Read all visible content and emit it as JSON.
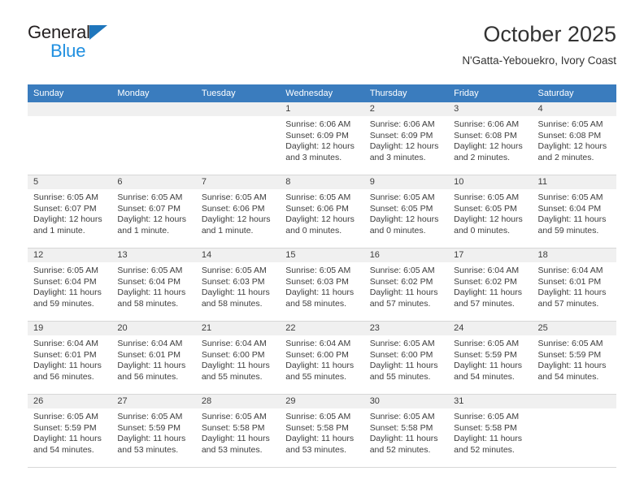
{
  "brand": {
    "line1": "General",
    "line2": "Blue",
    "triangle_color": "#1f76bc",
    "blue_text_color": "#1f8fe0"
  },
  "header": {
    "title": "October 2025",
    "subtitle": "N'Gatta-Yebouekro, Ivory Coast",
    "header_bg_color": "#3a7cbe",
    "daynum_band_color": "#f0f0f0"
  },
  "weekdays": [
    "Sunday",
    "Monday",
    "Tuesday",
    "Wednesday",
    "Thursday",
    "Friday",
    "Saturday"
  ],
  "labels": {
    "sunrise_prefix": "Sunrise:",
    "sunset_prefix": "Sunset:",
    "daylight_prefix": "Daylight:"
  },
  "weeks": [
    [
      {
        "day": "",
        "empty": true
      },
      {
        "day": "",
        "empty": true
      },
      {
        "day": "",
        "empty": true
      },
      {
        "day": "1",
        "sunrise": "Sunrise: 6:06 AM",
        "sunset": "Sunset: 6:09 PM",
        "daylight1": "Daylight: 12 hours",
        "daylight2": "and 3 minutes."
      },
      {
        "day": "2",
        "sunrise": "Sunrise: 6:06 AM",
        "sunset": "Sunset: 6:09 PM",
        "daylight1": "Daylight: 12 hours",
        "daylight2": "and 3 minutes."
      },
      {
        "day": "3",
        "sunrise": "Sunrise: 6:06 AM",
        "sunset": "Sunset: 6:08 PM",
        "daylight1": "Daylight: 12 hours",
        "daylight2": "and 2 minutes."
      },
      {
        "day": "4",
        "sunrise": "Sunrise: 6:05 AM",
        "sunset": "Sunset: 6:08 PM",
        "daylight1": "Daylight: 12 hours",
        "daylight2": "and 2 minutes."
      }
    ],
    [
      {
        "day": "5",
        "sunrise": "Sunrise: 6:05 AM",
        "sunset": "Sunset: 6:07 PM",
        "daylight1": "Daylight: 12 hours",
        "daylight2": "and 1 minute."
      },
      {
        "day": "6",
        "sunrise": "Sunrise: 6:05 AM",
        "sunset": "Sunset: 6:07 PM",
        "daylight1": "Daylight: 12 hours",
        "daylight2": "and 1 minute."
      },
      {
        "day": "7",
        "sunrise": "Sunrise: 6:05 AM",
        "sunset": "Sunset: 6:06 PM",
        "daylight1": "Daylight: 12 hours",
        "daylight2": "and 1 minute."
      },
      {
        "day": "8",
        "sunrise": "Sunrise: 6:05 AM",
        "sunset": "Sunset: 6:06 PM",
        "daylight1": "Daylight: 12 hours",
        "daylight2": "and 0 minutes."
      },
      {
        "day": "9",
        "sunrise": "Sunrise: 6:05 AM",
        "sunset": "Sunset: 6:05 PM",
        "daylight1": "Daylight: 12 hours",
        "daylight2": "and 0 minutes."
      },
      {
        "day": "10",
        "sunrise": "Sunrise: 6:05 AM",
        "sunset": "Sunset: 6:05 PM",
        "daylight1": "Daylight: 12 hours",
        "daylight2": "and 0 minutes."
      },
      {
        "day": "11",
        "sunrise": "Sunrise: 6:05 AM",
        "sunset": "Sunset: 6:04 PM",
        "daylight1": "Daylight: 11 hours",
        "daylight2": "and 59 minutes."
      }
    ],
    [
      {
        "day": "12",
        "sunrise": "Sunrise: 6:05 AM",
        "sunset": "Sunset: 6:04 PM",
        "daylight1": "Daylight: 11 hours",
        "daylight2": "and 59 minutes."
      },
      {
        "day": "13",
        "sunrise": "Sunrise: 6:05 AM",
        "sunset": "Sunset: 6:04 PM",
        "daylight1": "Daylight: 11 hours",
        "daylight2": "and 58 minutes."
      },
      {
        "day": "14",
        "sunrise": "Sunrise: 6:05 AM",
        "sunset": "Sunset: 6:03 PM",
        "daylight1": "Daylight: 11 hours",
        "daylight2": "and 58 minutes."
      },
      {
        "day": "15",
        "sunrise": "Sunrise: 6:05 AM",
        "sunset": "Sunset: 6:03 PM",
        "daylight1": "Daylight: 11 hours",
        "daylight2": "and 58 minutes."
      },
      {
        "day": "16",
        "sunrise": "Sunrise: 6:05 AM",
        "sunset": "Sunset: 6:02 PM",
        "daylight1": "Daylight: 11 hours",
        "daylight2": "and 57 minutes."
      },
      {
        "day": "17",
        "sunrise": "Sunrise: 6:04 AM",
        "sunset": "Sunset: 6:02 PM",
        "daylight1": "Daylight: 11 hours",
        "daylight2": "and 57 minutes."
      },
      {
        "day": "18",
        "sunrise": "Sunrise: 6:04 AM",
        "sunset": "Sunset: 6:01 PM",
        "daylight1": "Daylight: 11 hours",
        "daylight2": "and 57 minutes."
      }
    ],
    [
      {
        "day": "19",
        "sunrise": "Sunrise: 6:04 AM",
        "sunset": "Sunset: 6:01 PM",
        "daylight1": "Daylight: 11 hours",
        "daylight2": "and 56 minutes."
      },
      {
        "day": "20",
        "sunrise": "Sunrise: 6:04 AM",
        "sunset": "Sunset: 6:01 PM",
        "daylight1": "Daylight: 11 hours",
        "daylight2": "and 56 minutes."
      },
      {
        "day": "21",
        "sunrise": "Sunrise: 6:04 AM",
        "sunset": "Sunset: 6:00 PM",
        "daylight1": "Daylight: 11 hours",
        "daylight2": "and 55 minutes."
      },
      {
        "day": "22",
        "sunrise": "Sunrise: 6:04 AM",
        "sunset": "Sunset: 6:00 PM",
        "daylight1": "Daylight: 11 hours",
        "daylight2": "and 55 minutes."
      },
      {
        "day": "23",
        "sunrise": "Sunrise: 6:05 AM",
        "sunset": "Sunset: 6:00 PM",
        "daylight1": "Daylight: 11 hours",
        "daylight2": "and 55 minutes."
      },
      {
        "day": "24",
        "sunrise": "Sunrise: 6:05 AM",
        "sunset": "Sunset: 5:59 PM",
        "daylight1": "Daylight: 11 hours",
        "daylight2": "and 54 minutes."
      },
      {
        "day": "25",
        "sunrise": "Sunrise: 6:05 AM",
        "sunset": "Sunset: 5:59 PM",
        "daylight1": "Daylight: 11 hours",
        "daylight2": "and 54 minutes."
      }
    ],
    [
      {
        "day": "26",
        "sunrise": "Sunrise: 6:05 AM",
        "sunset": "Sunset: 5:59 PM",
        "daylight1": "Daylight: 11 hours",
        "daylight2": "and 54 minutes."
      },
      {
        "day": "27",
        "sunrise": "Sunrise: 6:05 AM",
        "sunset": "Sunset: 5:59 PM",
        "daylight1": "Daylight: 11 hours",
        "daylight2": "and 53 minutes."
      },
      {
        "day": "28",
        "sunrise": "Sunrise: 6:05 AM",
        "sunset": "Sunset: 5:58 PM",
        "daylight1": "Daylight: 11 hours",
        "daylight2": "and 53 minutes."
      },
      {
        "day": "29",
        "sunrise": "Sunrise: 6:05 AM",
        "sunset": "Sunset: 5:58 PM",
        "daylight1": "Daylight: 11 hours",
        "daylight2": "and 53 minutes."
      },
      {
        "day": "30",
        "sunrise": "Sunrise: 6:05 AM",
        "sunset": "Sunset: 5:58 PM",
        "daylight1": "Daylight: 11 hours",
        "daylight2": "and 52 minutes."
      },
      {
        "day": "31",
        "sunrise": "Sunrise: 6:05 AM",
        "sunset": "Sunset: 5:58 PM",
        "daylight1": "Daylight: 11 hours",
        "daylight2": "and 52 minutes."
      },
      {
        "day": "",
        "empty": true
      }
    ]
  ]
}
